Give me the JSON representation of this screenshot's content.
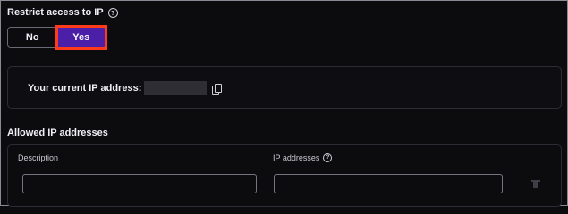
{
  "restrict": {
    "label": "Restrict access to IP",
    "options": [
      "No",
      "Yes"
    ],
    "selected": "Yes"
  },
  "current_ip": {
    "label": "Your current IP address:",
    "value_masked": true
  },
  "allowed": {
    "title": "Allowed IP addresses",
    "columns": {
      "description": "Description",
      "ip_addresses": "IP addresses"
    },
    "rows": [
      {
        "description": "",
        "ip_addresses": ""
      }
    ]
  },
  "colors": {
    "accent": "#4c1fa8",
    "highlight": "#ff3b1a",
    "background": "#0c0c0f"
  }
}
